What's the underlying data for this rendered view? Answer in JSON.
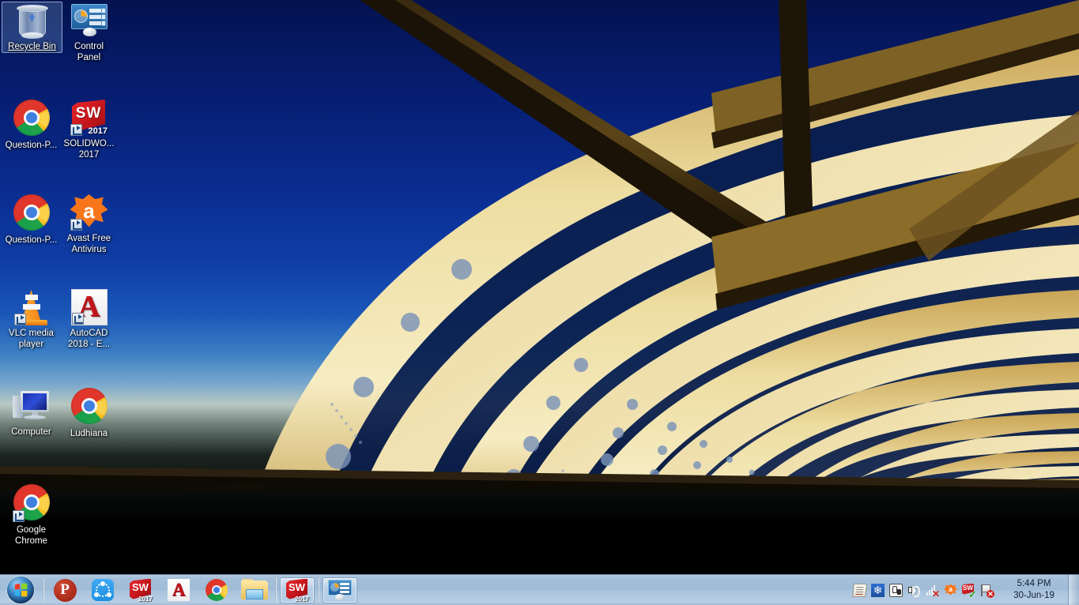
{
  "desktop": {
    "wallpaper_name": "architecture-bridge-canopy",
    "colors": {
      "sky_top": "#04124f",
      "sky_mid": "#0f3ea6",
      "horizon": "#b9c8c2",
      "structure_lit": "#f0dda0",
      "structure_dark": "#2a1d0a",
      "foreground": "#000000",
      "taskbar": "#a9c3dd",
      "selection": "#78a0d2"
    },
    "icons": [
      {
        "name": "recycle-bin",
        "label": "Recycle Bin",
        "selected": true,
        "shortcut": false,
        "col": 0,
        "row": 0
      },
      {
        "name": "control-panel",
        "label": "Control Panel",
        "selected": false,
        "shortcut": false,
        "col": 1,
        "row": 0
      },
      {
        "name": "question-paper-chrome-1",
        "label": "Question-P...",
        "selected": false,
        "shortcut": false,
        "col": 0,
        "row": 1
      },
      {
        "name": "solidworks-2017",
        "label": "SOLIDWO...\n2017",
        "selected": false,
        "shortcut": true,
        "col": 1,
        "row": 1
      },
      {
        "name": "question-paper-chrome-2",
        "label": "Question-P...",
        "selected": false,
        "shortcut": false,
        "col": 0,
        "row": 2
      },
      {
        "name": "avast-free-antivirus",
        "label": "Avast Free Antivirus",
        "selected": false,
        "shortcut": true,
        "col": 1,
        "row": 2
      },
      {
        "name": "vlc-media-player",
        "label": "VLC media player",
        "selected": false,
        "shortcut": true,
        "col": 0,
        "row": 3
      },
      {
        "name": "autocad-2018",
        "label": "AutoCAD 2018 - E...",
        "selected": false,
        "shortcut": true,
        "col": 1,
        "row": 3
      },
      {
        "name": "computer",
        "label": "Computer",
        "selected": false,
        "shortcut": false,
        "col": 0,
        "row": 4
      },
      {
        "name": "ludhiana-chrome",
        "label": "Ludhiana",
        "selected": false,
        "shortcut": false,
        "col": 1,
        "row": 4
      },
      {
        "name": "google-chrome",
        "label": "Google Chrome",
        "selected": false,
        "shortcut": true,
        "col": 0,
        "row": 5
      }
    ],
    "icon_labels": {
      "recycle_bin": "Recycle Bin",
      "control_panel_line1": "Control",
      "control_panel_line2": "Panel",
      "question_paper_1": "Question-P...",
      "solidworks_line1": "SOLIDWO...",
      "solidworks_line2": "2017",
      "question_paper_2": "Question-P...",
      "avast_line1": "Avast Free",
      "avast_line2": "Antivirus",
      "vlc_line1": "VLC media",
      "vlc_line2": "player",
      "autocad_line1": "AutoCAD",
      "autocad_line2": "2018 - E...",
      "computer": "Computer",
      "ludhiana": "Ludhiana",
      "chrome_line1": "Google",
      "chrome_line2": "Chrome"
    },
    "icon_badges": {
      "solidworks_brand": "SW",
      "solidworks_year": "2017",
      "avast_letter": "a",
      "autocad_letter": "A"
    }
  },
  "taskbar": {
    "start_button": {
      "name": "start-orb",
      "tooltip": "Start"
    },
    "pinned": [
      {
        "name": "taskbar-psiphon",
        "label": "P",
        "active": false
      },
      {
        "name": "taskbar-shareit",
        "label": "SHAREit",
        "active": false
      },
      {
        "name": "taskbar-solidworks",
        "label": "SOLIDWORKS 2017",
        "brand": "SW",
        "year": "2017",
        "active": false
      },
      {
        "name": "taskbar-autocad",
        "label": "A",
        "active": false
      },
      {
        "name": "taskbar-chrome",
        "label": "Google Chrome",
        "active": false
      },
      {
        "name": "taskbar-explorer",
        "label": "Windows Explorer",
        "active": false
      }
    ],
    "windows": [
      {
        "name": "taskbar-window-solidworks",
        "label": "SOLIDWORKS 2017",
        "brand": "SW",
        "year": "2017",
        "active": true
      },
      {
        "name": "taskbar-window-control-panel",
        "label": "Control Panel",
        "active": true
      }
    ],
    "tray": {
      "icons": [
        {
          "name": "notepad-tray-icon",
          "label": "Notepad"
        },
        {
          "name": "snowflake-tray-icon",
          "label": "Defragmenter",
          "glyph": "❄"
        },
        {
          "name": "safely-remove-hardware-icon",
          "label": "Safely Remove Hardware"
        },
        {
          "name": "volume-icon",
          "label": "Volume"
        },
        {
          "name": "network-icon",
          "label": "Network — not connected",
          "badge": "✕"
        },
        {
          "name": "avast-tray-icon",
          "label": "Avast Antivirus",
          "glyph": "a"
        },
        {
          "name": "solidworks-tray-icon",
          "label": "SOLIDWORKS",
          "glyph": "SW",
          "badge": "✓"
        },
        {
          "name": "action-center-icon",
          "label": "Action Center",
          "badge": "✕"
        }
      ]
    },
    "clock": {
      "time": "5:44 PM",
      "date": "30-Jun-19"
    },
    "show_desktop": {
      "label": "Show desktop"
    }
  }
}
